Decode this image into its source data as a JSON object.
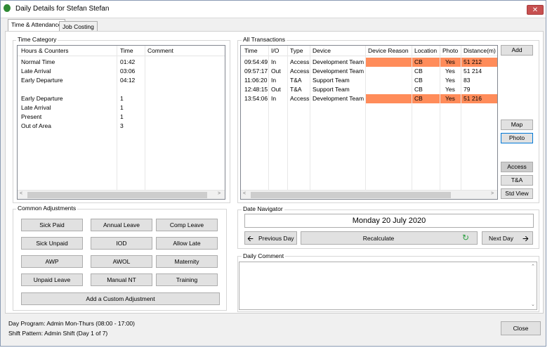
{
  "window": {
    "title": "Daily Details for Stefan Stefan",
    "close_glyph": "✕"
  },
  "tabs": [
    {
      "label": "Time & Attendance"
    },
    {
      "label": "Job Costing"
    }
  ],
  "time_category": {
    "group_label": "Time Category",
    "headers": [
      "Hours & Counters",
      "Time",
      "Comment"
    ],
    "rows": [
      [
        "Normal Time",
        "01:42",
        ""
      ],
      [
        "Late Arrival",
        "03:06",
        ""
      ],
      [
        "Early Departure",
        "04:12",
        ""
      ],
      [
        "",
        "",
        ""
      ],
      [
        "Early Departure",
        "1",
        ""
      ],
      [
        "Late Arrival",
        "1",
        ""
      ],
      [
        "Present",
        "1",
        ""
      ],
      [
        "Out of Area",
        "3",
        ""
      ]
    ]
  },
  "transactions": {
    "group_label": "All Transactions",
    "headers": [
      "Time",
      "I/O",
      "Type",
      "Device",
      "Device Reason",
      "Location",
      "Photo",
      "Distance(m)"
    ],
    "rows": [
      {
        "cells": [
          "09:54:49",
          "In",
          "Access",
          "Development Team",
          "",
          "CB",
          "Yes",
          "51 212"
        ],
        "highlight": true
      },
      {
        "cells": [
          "09:57:17",
          "Out",
          "Access",
          "Development Team",
          "",
          "CB",
          "Yes",
          "51 214"
        ],
        "highlight": false
      },
      {
        "cells": [
          "11:06:20",
          "In",
          "T&A",
          "Support Team",
          "",
          "CB",
          "Yes",
          "83"
        ],
        "highlight": false
      },
      {
        "cells": [
          "12:48:15",
          "Out",
          "T&A",
          "Support Team",
          "",
          "CB",
          "Yes",
          "79"
        ],
        "highlight": false
      },
      {
        "cells": [
          "13:54:06",
          "In",
          "Access",
          "Development Team",
          "",
          "CB",
          "Yes",
          "51 216"
        ],
        "highlight": true
      }
    ],
    "highlight_color": "#ff8c5a"
  },
  "side_buttons": {
    "add": "Add",
    "map": "Map",
    "photo": "Photo",
    "access": "Access",
    "ta": "T&A",
    "std_view": "Std View"
  },
  "common_adjustments": {
    "group_label": "Common Adjustments",
    "buttons": [
      "Sick Paid",
      "Annual Leave",
      "Comp Leave",
      "Sick Unpaid",
      "IOD",
      "Allow Late",
      "AWP",
      "AWOL",
      "Maternity",
      "Unpaid Leave",
      "Manual NT",
      "Training"
    ],
    "custom": "Add a Custom Adjustment"
  },
  "date_navigator": {
    "group_label": "Date Navigator",
    "date": "Monday 20 July 2020",
    "prev": "Previous Day",
    "recalc": "Recalculate",
    "next": "Next Day"
  },
  "daily_comment": {
    "label": "Daily Comment",
    "value": ""
  },
  "footer": {
    "day_program": "Day Program:  Admin Mon-Thurs  (08:00 - 17:00)",
    "shift_pattern": "Shift Pattern:  Admin Shift  (Day 1 of 7)",
    "close": "Close"
  }
}
